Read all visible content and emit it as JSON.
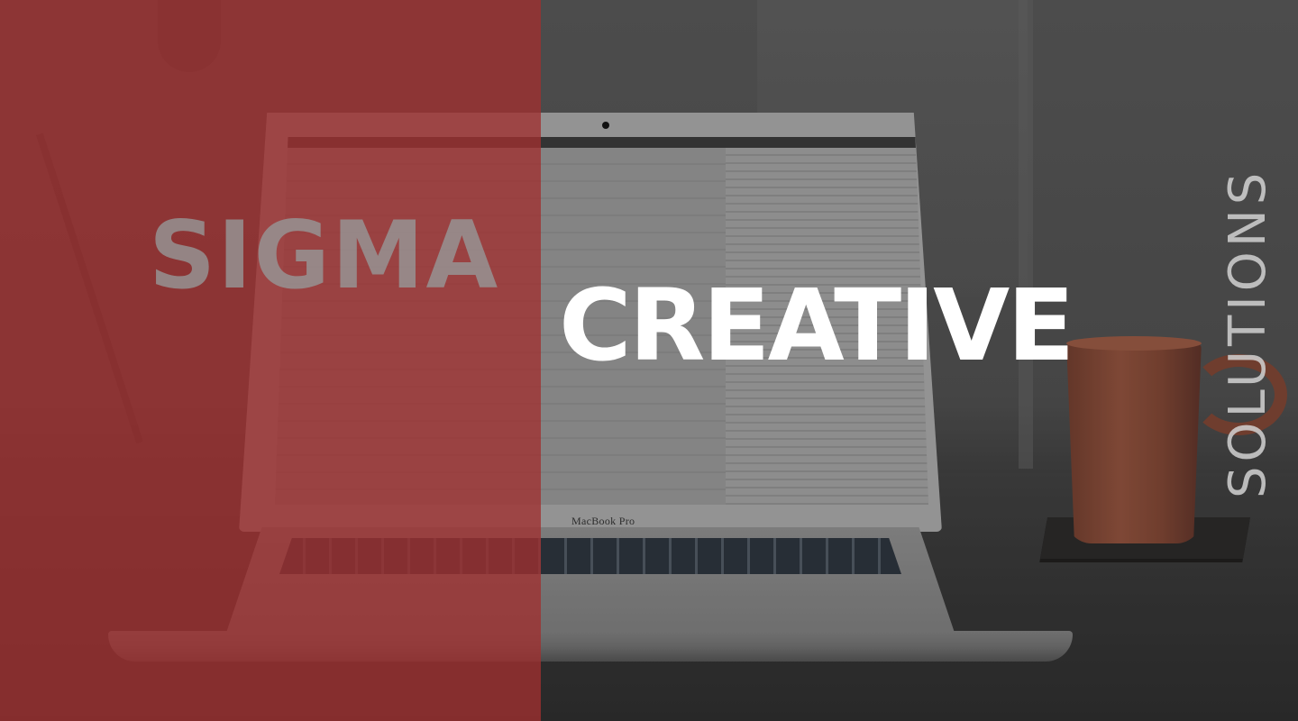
{
  "hero": {
    "brand_word": "SIGMA",
    "headline": "CREATIVE",
    "tagline": "SOLUTIONS"
  },
  "background": {
    "device_label": "MacBook Pro",
    "description_icon": "laptop-icon",
    "accent_color": "#a03030"
  }
}
